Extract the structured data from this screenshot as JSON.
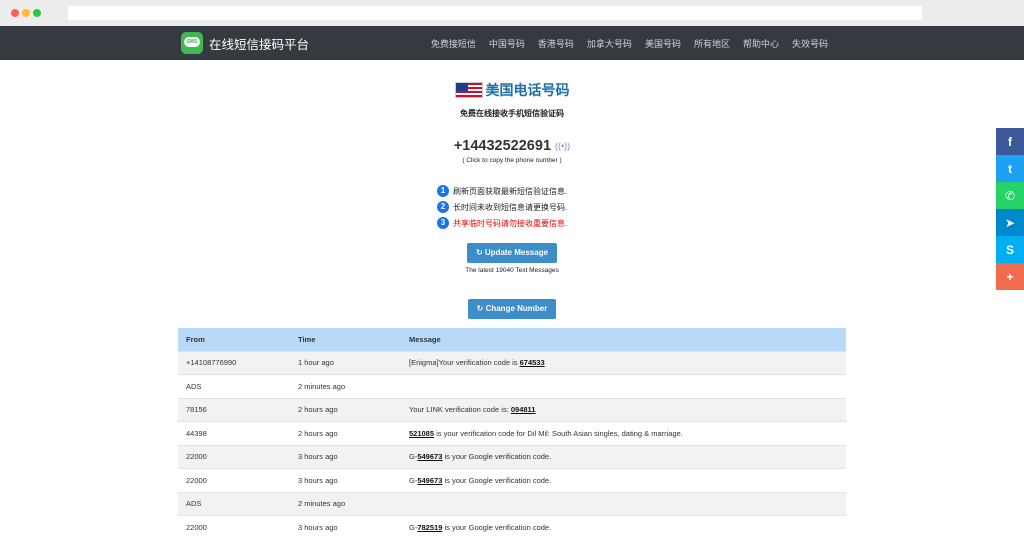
{
  "brand": {
    "name": "在线短信接码平台",
    "logo_text": "SMS"
  },
  "nav": [
    "免费接短信",
    "中国号码",
    "香港号码",
    "加拿大号码",
    "美国号码",
    "所有地区",
    "帮助中心",
    "失效号码"
  ],
  "header": {
    "title": "美国电话号码",
    "subtitle": "免费在线接收手机短信验证码",
    "phone": "+14432522691",
    "copy_hint": "( Click to copy the phone number )"
  },
  "notes": [
    {
      "num": "1",
      "text": "刷新页面获取最新短信验证信息."
    },
    {
      "num": "2",
      "text": "长时间未收到短信息请更换号码."
    },
    {
      "num": "3",
      "text": "共享临时号码请勿接收重要信息."
    }
  ],
  "buttons": {
    "update": "↻ Update Message",
    "latest": "The latest 19040 Text Messages",
    "change": "↻ Change Number"
  },
  "table": {
    "headers": [
      "From",
      "Time",
      "Message"
    ],
    "rows": [
      {
        "from": "+14108776990",
        "time": "1 hour ago",
        "pre": "[Enigma]Your verification code is ",
        "code": "674533",
        "post": ""
      },
      {
        "from": "ADS",
        "time": "2 minutes ago",
        "pre": "",
        "code": "",
        "post": ""
      },
      {
        "from": "78156",
        "time": "2 hours ago",
        "pre": "Your LINK verification code is: ",
        "code": "094811",
        "post": ""
      },
      {
        "from": "44398",
        "time": "2 hours ago",
        "pre": "",
        "code": "521085",
        "post": " is your verification code for Dil Mil: South Asian singles, dating & marriage."
      },
      {
        "from": "22000",
        "time": "3 hours ago",
        "pre": "G-",
        "code": "549673",
        "post": " is your Google verification code."
      },
      {
        "from": "22000",
        "time": "3 hours ago",
        "pre": "G-",
        "code": "549673",
        "post": " is your Google verification code."
      },
      {
        "from": "ADS",
        "time": "2 minutes ago",
        "pre": "",
        "code": "",
        "post": ""
      },
      {
        "from": "22000",
        "time": "3 hours ago",
        "pre": "G-",
        "code": "782519",
        "post": " is your Google verification code."
      }
    ]
  },
  "share": [
    {
      "name": "facebook-icon",
      "glyph": "f"
    },
    {
      "name": "twitter-icon",
      "glyph": "t"
    },
    {
      "name": "whatsapp-icon",
      "glyph": "✆"
    },
    {
      "name": "telegram-icon",
      "glyph": "➤"
    },
    {
      "name": "skype-icon",
      "glyph": "S"
    },
    {
      "name": "more-share-icon",
      "glyph": "+"
    }
  ]
}
